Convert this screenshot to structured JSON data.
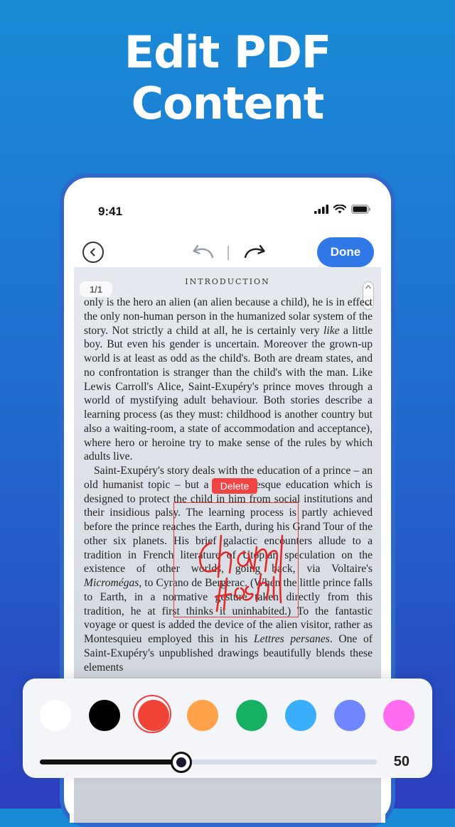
{
  "headline": {
    "line1": "Edit PDF",
    "line2": "Content"
  },
  "status_bar": {
    "time": "9:41"
  },
  "toolbar": {
    "done_label": "Done"
  },
  "document": {
    "heading": "INTRODUCTION",
    "page_indicator": "1/1",
    "paragraphs": [
      "only is the hero an alien (an alien because a child), he is in effect the only non-human person in the humanized solar system of the story. Not strictly a child at all, he is certainly very like a little boy. But even his gender is uncertain. Moreover the grown-up world is at least as odd as the child's. Both are dream states, and no confrontation is stranger than the child's with the man. Like Lewis Carroll's Alice, Saint-Exupéry's prince moves through a world of mystifying adult behaviour. Both stories describe a learning process (as they must: childhood is another country but also a waiting-room, a state of accommodation and acceptance), where hero or heroine try to make sense of the rules by which adults live.",
      "Saint-Exupéry's story deals with the education of a prince – an old humanist topic – but a Rousseauesque education which is designed to protect the child in him from social institutions and their insidious palsy. The learning process is partly achieved before the prince reaches the Earth, during his Grand Tour of the other six planets. His brief galactic encounters allude to a tradition in French literature of Utopian speculation on the existence of other worlds, going back, via Voltaire's Micromégas, to Cyrano de Bergerac. (When the little prince falls to Earth, in a normative gesture taken directly from this tradition, he at first thinks it uninhabited.) To the fantastic voyage or quest is added the device of the alien visitor, rather as Montesquieu employed this in his Lettres persanes. One of Saint-Exupéry's unpublished drawings beautifully blends these elements"
    ],
    "delete_label": "Delete"
  },
  "palette": {
    "colors": [
      {
        "name": "white",
        "hex": "#ffffff"
      },
      {
        "name": "black",
        "hex": "#000000"
      },
      {
        "name": "red",
        "hex": "#f04438"
      },
      {
        "name": "orange",
        "hex": "#ffa24a"
      },
      {
        "name": "green",
        "hex": "#16b063"
      },
      {
        "name": "sky-blue",
        "hex": "#3aaefc"
      },
      {
        "name": "periwinkle",
        "hex": "#6f86ff"
      },
      {
        "name": "pink",
        "hex": "#ff6cf0"
      }
    ],
    "selected_index": 2
  },
  "slider": {
    "value": 50,
    "fraction": 0.42,
    "value_label": "50"
  }
}
